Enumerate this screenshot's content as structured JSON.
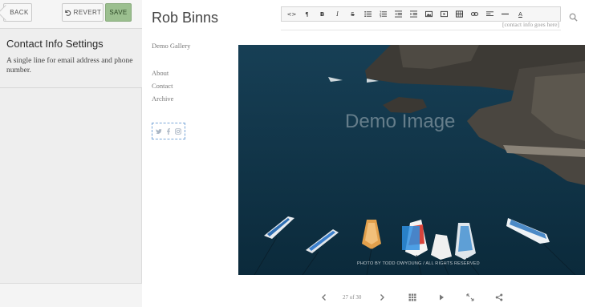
{
  "panel": {
    "back_label": "BACK",
    "revert_label": "REVERT",
    "save_label": "SAVE",
    "section_title": "Contact Info Settings",
    "section_description": "A single line for email address and phone number."
  },
  "site": {
    "title": "Rob Binns",
    "nav": {
      "gallery": "Demo Gallery",
      "about": "About",
      "contact": "Contact",
      "archive": "Archive"
    },
    "social_icons": [
      "twitter-icon",
      "facebook-icon",
      "instagram-icon"
    ],
    "contact_placeholder": "[contact info goes here]"
  },
  "editor_toolbar": {
    "code_label": "<>",
    "paragraph_label": "¶",
    "bold_label": "B",
    "italic_label": "I",
    "strike_label": "S",
    "underline_color_label": "A",
    "buttons": [
      "code",
      "paragraph",
      "bold",
      "italic",
      "strikethrough",
      "unordered-list",
      "ordered-list",
      "outdent",
      "indent",
      "image",
      "video",
      "table",
      "link",
      "align",
      "horizontal-rule",
      "font-color"
    ]
  },
  "photo": {
    "watermark": "Demo Image",
    "credit": "PHOTO BY TODD OWYOUNG / ALL RIGHTS RESERVED"
  },
  "gallery": {
    "counter": "27 of 30"
  },
  "colors": {
    "save_green": "#9bbf8f",
    "panel_bg": "#eeeeee",
    "selection_blue": "#7aa7d8",
    "sea": "#10374d"
  }
}
